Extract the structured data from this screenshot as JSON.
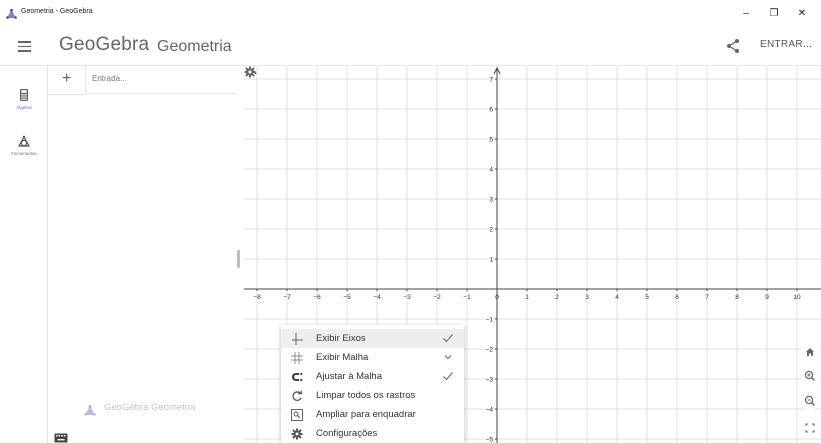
{
  "window": {
    "title": "Geometria - GeoGebra",
    "controls": [
      "–",
      "❐",
      "✕"
    ]
  },
  "header": {
    "logo": "GeoGebra",
    "app_name": "Geometria",
    "share_icon": "share-icon",
    "signin_label": "ENTRAR..."
  },
  "sidebar": {
    "items": [
      {
        "label": "Álgebra",
        "icon": "calculator-icon",
        "active": true
      },
      {
        "label": "Ferramentas",
        "icon": "tools-icon",
        "active": false
      }
    ]
  },
  "algebra": {
    "add_label": "+",
    "input_placeholder": "Entrada...",
    "watermark": "GeoGebra Geometria"
  },
  "graphics": {
    "x_ticks": [
      "−8",
      "−7",
      "−6",
      "−5",
      "−4",
      "−3",
      "−2",
      "−1",
      "0",
      "1",
      "2",
      "3",
      "4",
      "5",
      "6",
      "7",
      "8",
      "9",
      "10"
    ],
    "y_ticks": [
      "7",
      "6",
      "5",
      "4",
      "3",
      "2",
      "1",
      "−1",
      "−2",
      "−3",
      "−4",
      "−5"
    ]
  },
  "context_menu": {
    "items": [
      {
        "label": "Exibir Eixos",
        "icon": "axes-icon",
        "right": "check"
      },
      {
        "label": "Exibir Malha",
        "icon": "grid-icon",
        "right": "chevron"
      },
      {
        "label": "Ajustar à Malha",
        "icon": "magnet-icon",
        "right": "check"
      },
      {
        "label": "Limpar todos os rastros",
        "icon": "refresh-icon",
        "right": ""
      },
      {
        "label": "Ampliar para enquadrar",
        "icon": "zoom-fit-icon",
        "right": ""
      },
      {
        "label": "Configurações",
        "icon": "gear-icon",
        "right": ""
      }
    ]
  },
  "colors": {
    "accent": "#8a5ab8",
    "grid": "#e2e2e2",
    "axis": "#444444"
  }
}
